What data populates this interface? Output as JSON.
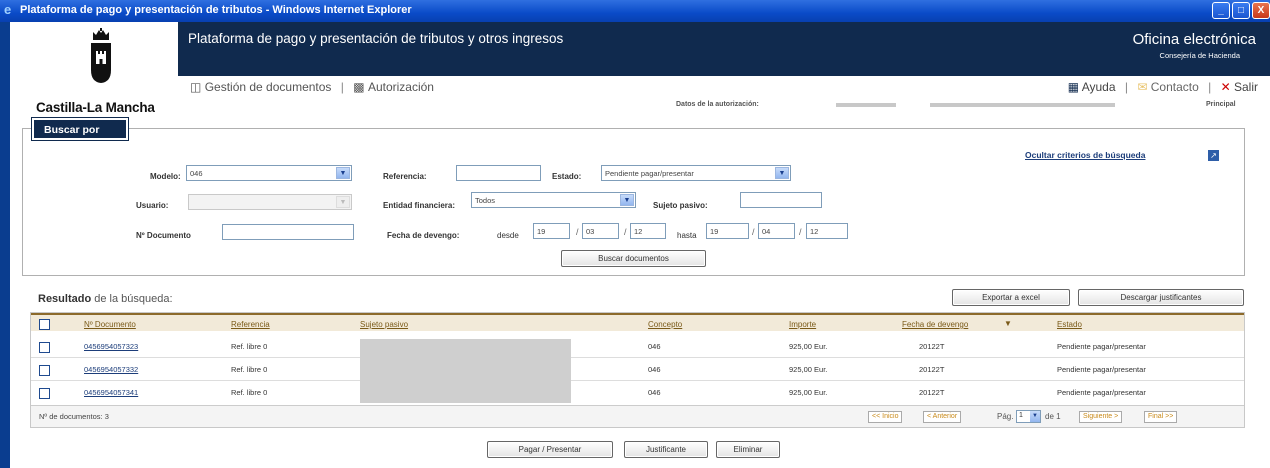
{
  "window": {
    "title": "Plataforma de pago y presentación de tributos - Windows Internet Explorer",
    "minimize": "_",
    "maximize": "□",
    "close": "X"
  },
  "header": {
    "title": "Plataforma de pago y presentación de tributos y otros ingresos",
    "office_title": "Oficina electrónica",
    "office_subtitle": "Consejería de Hacienda",
    "logo_text": "Castilla-La Mancha"
  },
  "nav": {
    "items": [
      {
        "label": "Gestión de documentos",
        "icon": "documents-icon"
      },
      {
        "label": "Autorización",
        "icon": "authorization-icon"
      }
    ],
    "right": [
      {
        "label": "Ayuda",
        "icon": "help-icon"
      },
      {
        "label": "Contacto",
        "icon": "mail-icon"
      },
      {
        "label": "Salir",
        "icon": "close-x-icon"
      }
    ],
    "separator": "|",
    "auth_label": "Datos de la autorización:",
    "principal": "Principal"
  },
  "search": {
    "tab_label": "Buscar por",
    "hide_criteria": "Ocultar criterios de búsqueda",
    "modelo_label": "Modelo:",
    "modelo_value": "046",
    "referencia_label": "Referencia:",
    "referencia_value": "",
    "estado_label": "Estado:",
    "estado_value": "Pendiente pagar/presentar",
    "usuario_label": "Usuario:",
    "usuario_value": "",
    "entidad_label": "Entidad financiera:",
    "entidad_value": "Todos",
    "sujeto_label": "Sujeto pasivo:",
    "sujeto_value": "",
    "documento_label": "Nº Documento",
    "documento_value": "",
    "fecha_label": "Fecha de devengo:",
    "desde_label": "desde",
    "desde": {
      "day": "19",
      "month": "03",
      "year": "12"
    },
    "hasta_label": "hasta",
    "hasta": {
      "day": "19",
      "month": "04",
      "year": "12"
    },
    "date_sep": "/",
    "search_button": "Buscar documentos"
  },
  "results": {
    "title_bold": "Resultado",
    "title_rest": "de la búsqueda:",
    "export_button": "Exportar a excel",
    "download_button": "Descargar justificantes",
    "columns": {
      "documento": "Nº Documento",
      "referencia": "Referencia",
      "sujeto": "Sujeto pasivo",
      "concepto": "Concepto",
      "importe": "Importe",
      "fecha": "Fecha de devengo",
      "estado": "Estado"
    },
    "sort_indicator": "▼",
    "rows": [
      {
        "documento": "0456954057323",
        "referencia": "Ref. libre 0",
        "concepto": "046",
        "importe": "925,00 Eur.",
        "fecha": "20122T",
        "estado": "Pendiente pagar/presentar"
      },
      {
        "documento": "0456954057332",
        "referencia": "Ref. libre 0",
        "concepto": "046",
        "importe": "925,00 Eur.",
        "fecha": "20122T",
        "estado": "Pendiente pagar/presentar"
      },
      {
        "documento": "0456954057341",
        "referencia": "Ref. libre 0",
        "concepto": "046",
        "importe": "925,00 Eur.",
        "fecha": "20122T",
        "estado": "Pendiente pagar/presentar"
      }
    ],
    "count_label": "Nº de documentos: 3",
    "pagination": {
      "first": "<< Inicio",
      "prev": "< Anterior",
      "page_label": "Pág.",
      "page_value": "1",
      "of_label": "de 1",
      "next": "Siguiente >",
      "last": "Final >>"
    }
  },
  "actions": {
    "pay": "Pagar / Presentar",
    "receipt": "Justificante",
    "delete": "Eliminar"
  },
  "colors": {
    "header_bg": "#102a4e",
    "titlebar": "#0a4bc8",
    "table_header_bg": "#f2ead9",
    "table_header_text": "#7a5a18",
    "link": "#1c3d7a",
    "pagination_text": "#c98a1a"
  }
}
